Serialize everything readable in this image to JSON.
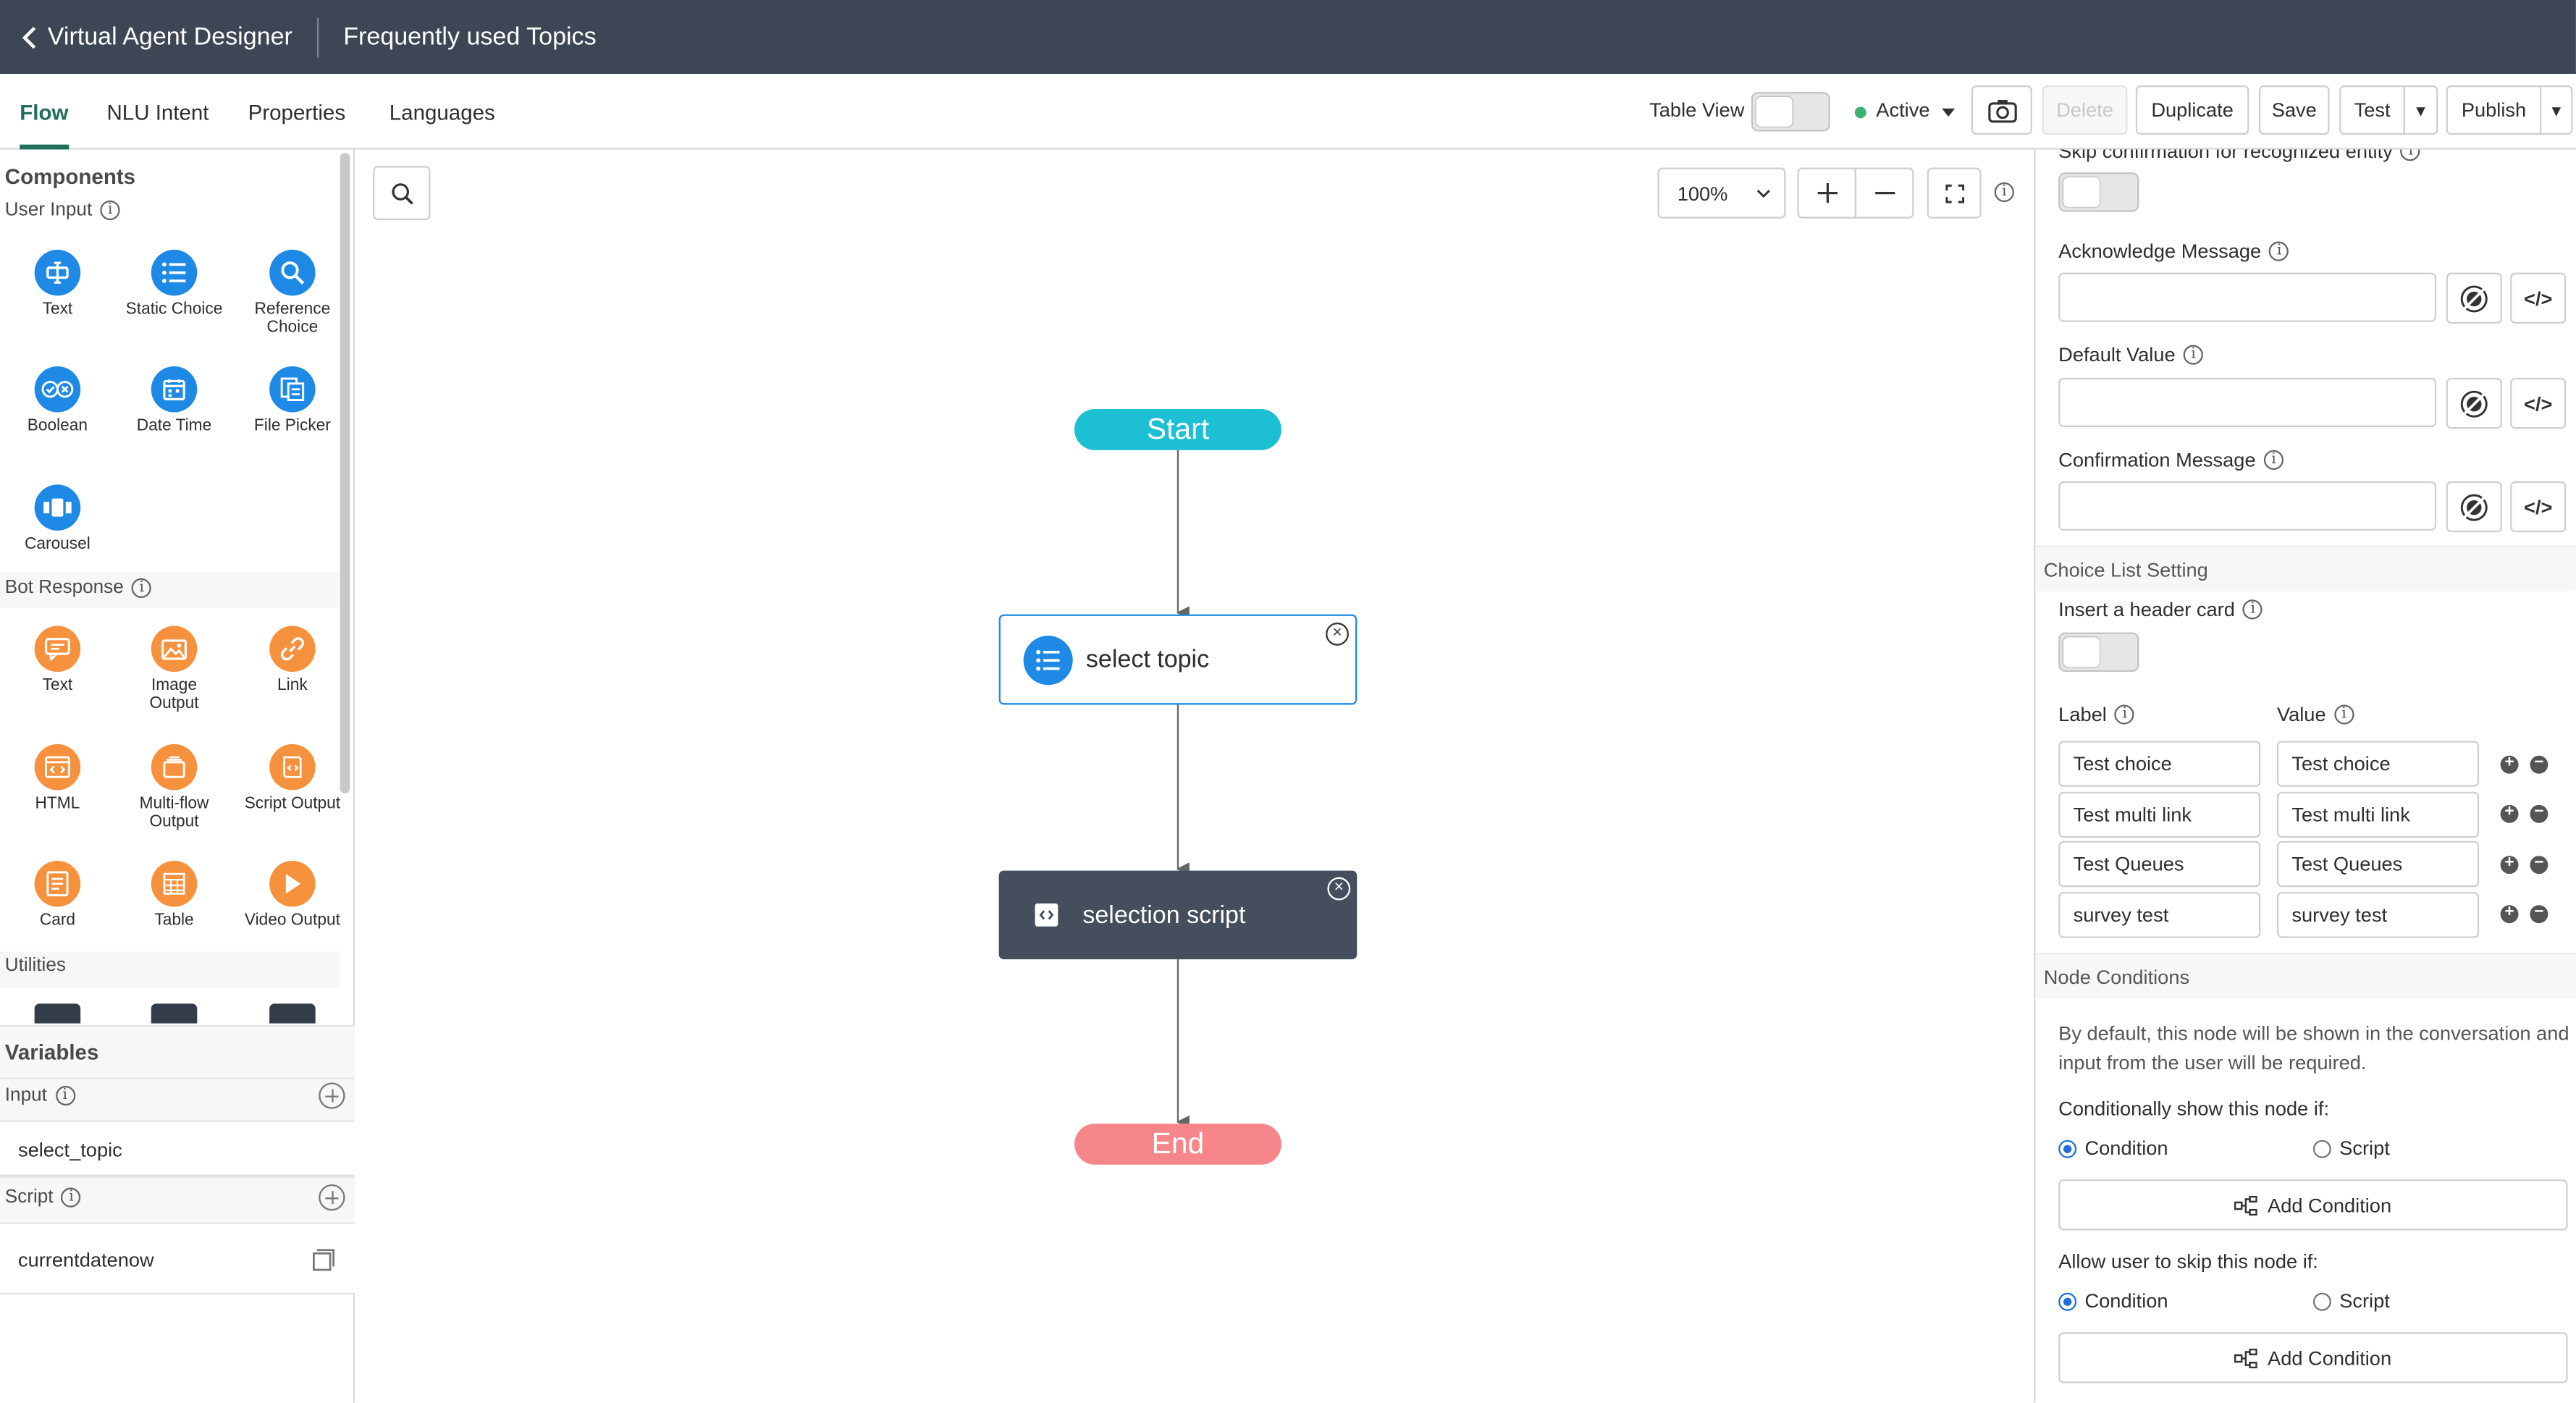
{
  "header": {
    "back_label": "Virtual Agent Designer",
    "title": "Frequently used Topics"
  },
  "tabs": [
    {
      "label": "Flow",
      "active": true
    },
    {
      "label": "NLU Intent"
    },
    {
      "label": "Properties"
    },
    {
      "label": "Languages"
    }
  ],
  "toolbar": {
    "table_view_label": "Table View",
    "status_label": "Active",
    "delete_label": "Delete",
    "duplicate_label": "Duplicate",
    "save_label": "Save",
    "test_label": "Test",
    "publish_label": "Publish",
    "split_caret": "▾"
  },
  "components": {
    "title": "Components",
    "user_input_title": "User Input",
    "user_input": [
      {
        "label": "Text",
        "icon": "text-input-icon"
      },
      {
        "label": "Static Choice",
        "icon": "list-icon"
      },
      {
        "label": "Reference Choice",
        "icon": "search-icon"
      },
      {
        "label": "Boolean",
        "icon": "boolean-icon"
      },
      {
        "label": "Date Time",
        "icon": "calendar-icon"
      },
      {
        "label": "File Picker",
        "icon": "file-picker-icon"
      },
      {
        "label": "Carousel",
        "icon": "carousel-icon"
      }
    ],
    "bot_response_title": "Bot Response",
    "bot_response": [
      {
        "label": "Text",
        "icon": "chat-bubble-icon"
      },
      {
        "label": "Image Output",
        "icon": "image-icon"
      },
      {
        "label": "Link",
        "icon": "link-icon"
      },
      {
        "label": "HTML",
        "icon": "html-icon"
      },
      {
        "label": "Multi-flow Output",
        "icon": "multi-flow-icon"
      },
      {
        "label": "Script Output",
        "icon": "script-icon"
      },
      {
        "label": "Card",
        "icon": "card-icon"
      },
      {
        "label": "Table",
        "icon": "table-icon"
      },
      {
        "label": "Video Output",
        "icon": "play-icon"
      }
    ],
    "utilities_title": "Utilities"
  },
  "variables": {
    "title": "Variables",
    "input_title": "Input",
    "input_items": [
      "select_topic"
    ],
    "script_title": "Script",
    "script_items": [
      "currentdatenow"
    ]
  },
  "canvas": {
    "zoom": "100%",
    "nodes": {
      "start": "Start",
      "node1": "select topic",
      "node2": "selection script",
      "end": "End"
    }
  },
  "properties": {
    "skip_confirmation_label": "Skip confirmation for recognized entity",
    "acknowledge_label": "Acknowledge Message",
    "default_value_label": "Default Value",
    "confirmation_label": "Confirmation Message",
    "choice_list_section": "Choice List Setting",
    "header_card_label": "Insert a header card",
    "label_col": "Label",
    "value_col": "Value",
    "choices": [
      {
        "label": "Test choice",
        "value": "Test choice"
      },
      {
        "label": "Test multi link",
        "value": "Test multi link"
      },
      {
        "label": "Test Queues",
        "value": "Test Queues"
      },
      {
        "label": "survey test",
        "value": "survey test"
      }
    ],
    "node_conditions_section": "Node Conditions",
    "node_conditions_desc": "By default, this node will be shown in the conversation and input from the user will be required.",
    "show_if_label": "Conditionally show this node if:",
    "skip_if_label": "Allow user to skip this node if:",
    "condition_option": "Condition",
    "script_option": "Script",
    "add_condition_label": "Add Condition",
    "code_glyph": "</>"
  }
}
